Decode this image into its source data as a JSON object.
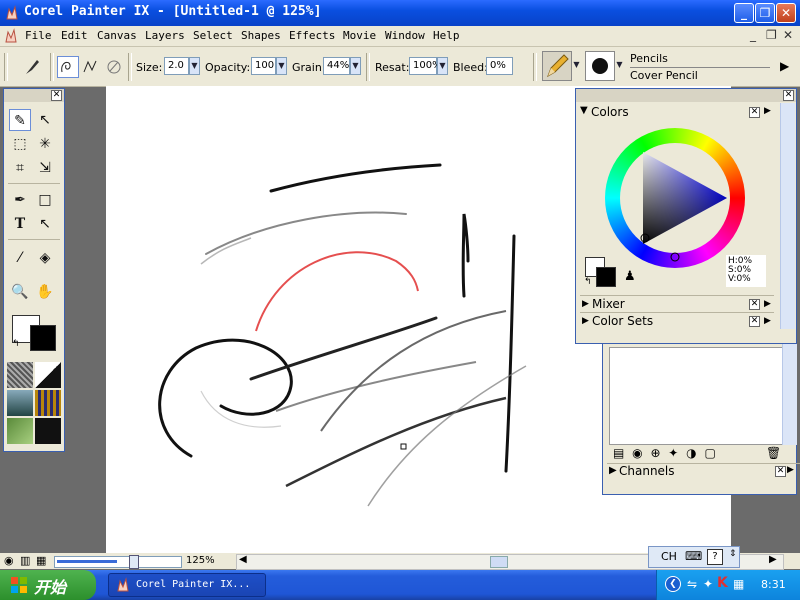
{
  "window": {
    "title": "Corel Painter IX - [Untitled-1 @ 125%]",
    "buttons": {
      "minimize": "_",
      "maximize": "❐",
      "close": "✕"
    }
  },
  "menu": {
    "items": [
      "File",
      "Edit",
      "Canvas",
      "Layers",
      "Select",
      "Shapes",
      "Effects",
      "Movie",
      "Window",
      "Help"
    ],
    "mdi_controls": [
      "_",
      "❐",
      "✕"
    ]
  },
  "property_bar": {
    "size_label": "Size:",
    "size_value": "2.0",
    "opacity_label": "Opacity:",
    "opacity_value": "100",
    "grain_label": "Grain:",
    "grain_value": "44%",
    "resat_label": "Resat:",
    "resat_value": "100%",
    "bleed_label": "Bleed:",
    "bleed_value": "0%",
    "brush_category": "Pencils",
    "brush_variant": "Cover Pencil"
  },
  "colors_panel": {
    "title": "Colors",
    "h": "H:0%",
    "s": "S:0%",
    "v": "V:0%",
    "sections": [
      "Mixer",
      "Color Sets"
    ]
  },
  "channels_panel": {
    "title": "Channels"
  },
  "status": {
    "zoom": "125%"
  },
  "ime": {
    "label": "CH"
  },
  "taskbar": {
    "start_label": "开始",
    "task_label": "Corel Painter IX...",
    "clock": "8:31"
  },
  "colors": {
    "titlebar": "#0a4fe0",
    "chrome": "#ece9d8",
    "taskbar": "#245ddb",
    "start_green": "#3ea33e",
    "stroke_red": "#e03030"
  }
}
